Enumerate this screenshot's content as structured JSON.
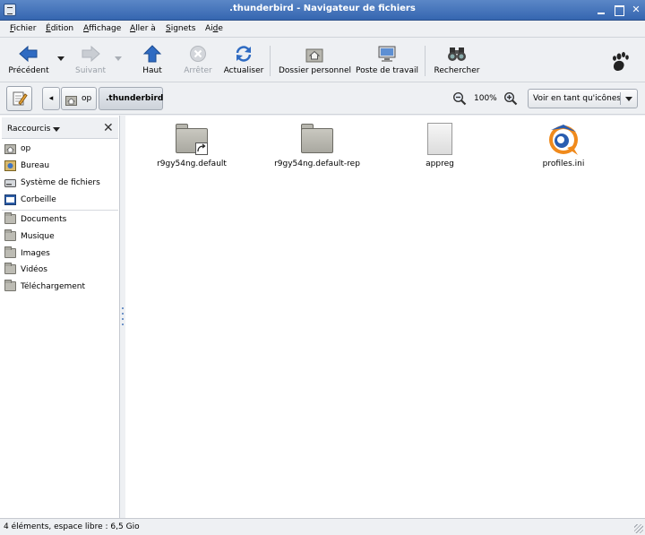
{
  "window": {
    "title": ".thunderbird - Navigateur de fichiers",
    "minimize": "_",
    "close": "✕"
  },
  "menubar": {
    "items": [
      {
        "label": "Fichier",
        "mnemonic": "F",
        "rest": "ichier"
      },
      {
        "label": "Édition",
        "mnemonic": "É",
        "rest": "dition"
      },
      {
        "label": "Affichage",
        "mnemonic": "A",
        "rest": "ffichage"
      },
      {
        "label": "Aller à",
        "mnemonic": "A",
        "rest": "ller à"
      },
      {
        "label": "Signets",
        "mnemonic": "S",
        "rest": "ignets"
      },
      {
        "label": "Aide",
        "mnemonic": "d",
        "pre": "Ai",
        "rest": "e"
      }
    ]
  },
  "toolbar": {
    "back": "Précédent",
    "forward": "Suivant",
    "up": "Haut",
    "stop": "Arrêter",
    "reload": "Actualiser",
    "home": "Dossier personnel",
    "desktop": "Poste de travail",
    "search": "Rechercher"
  },
  "location": {
    "left_arrow": "◂",
    "crumbs": [
      "op",
      ".thunderbird"
    ],
    "zoom": "100%",
    "view_mode": "Voir en tant qu'icônes"
  },
  "sidebar": {
    "title": "Raccourcis",
    "close": "✕",
    "places": [
      {
        "label": "op",
        "icon": "home-icon"
      },
      {
        "label": "Bureau",
        "icon": "desktop-icon"
      },
      {
        "label": "Système de fichiers",
        "icon": "drive-icon"
      },
      {
        "label": "Corbeille",
        "icon": "trash-icon"
      }
    ],
    "bookmarks": [
      {
        "label": "Documents"
      },
      {
        "label": "Musique"
      },
      {
        "label": "Images"
      },
      {
        "label": "Vidéos"
      },
      {
        "label": "Téléchargement"
      }
    ]
  },
  "files": [
    {
      "name": "r9gy54ng.default",
      "type": "folder-link"
    },
    {
      "name": "r9gy54ng.default-rep",
      "type": "folder"
    },
    {
      "name": "appreg",
      "type": "file"
    },
    {
      "name": "profiles.ini",
      "type": "config"
    }
  ],
  "status": {
    "text": "4 éléments, espace libre : 6,5 Gio"
  },
  "colors": {
    "titlebar": "#3d6db5",
    "back_arrow": "#2f6bc2",
    "up_arrow": "#2f6bc2"
  }
}
